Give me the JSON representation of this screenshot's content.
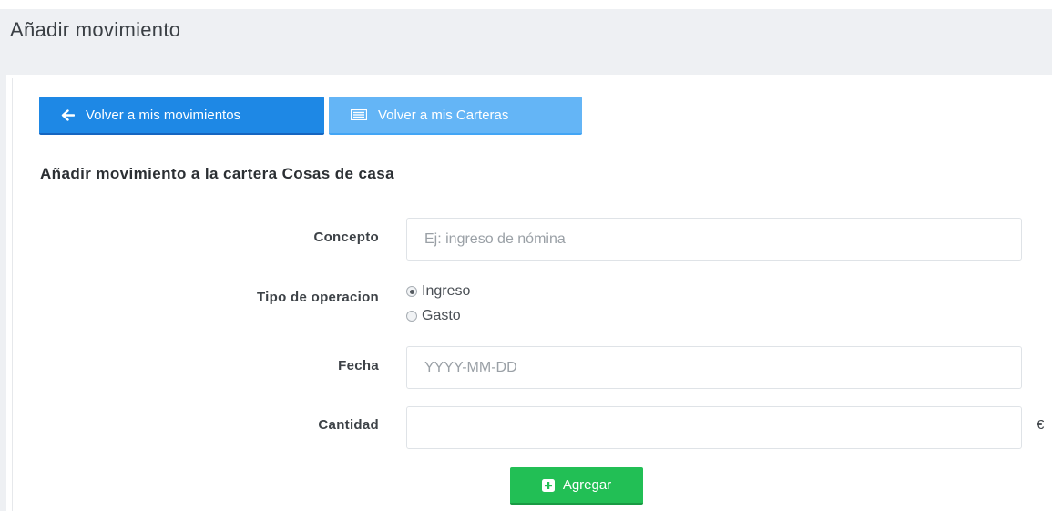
{
  "header": {
    "title": "Añadir movimiento"
  },
  "toolbar": {
    "back_label": "Volver a mis movimientos",
    "back_icon": "arrow-left-icon",
    "wallets_label": "Volver a mis Carteras",
    "wallets_icon": "list-icon"
  },
  "form": {
    "section_title": "Añadir movimiento a la cartera Cosas de casa",
    "concepto": {
      "label": "Concepto",
      "value": "",
      "placeholder": "Ej: ingreso de nómina"
    },
    "tipo": {
      "label": "Tipo de operacion",
      "options": [
        {
          "label": "Ingreso",
          "checked": true
        },
        {
          "label": "Gasto",
          "checked": false
        }
      ]
    },
    "fecha": {
      "label": "Fecha",
      "value": "",
      "placeholder": "YYYY-MM-DD"
    },
    "cantidad": {
      "label": "Cantidad",
      "value": "",
      "placeholder": "",
      "currency": "€"
    },
    "submit_label": "Agregar",
    "submit_icon": "plus-square-icon"
  },
  "colors": {
    "primary": "#1e88e5",
    "primary_light": "#64b5f6",
    "success": "#22bf55",
    "header_bg": "#eef0f3"
  }
}
